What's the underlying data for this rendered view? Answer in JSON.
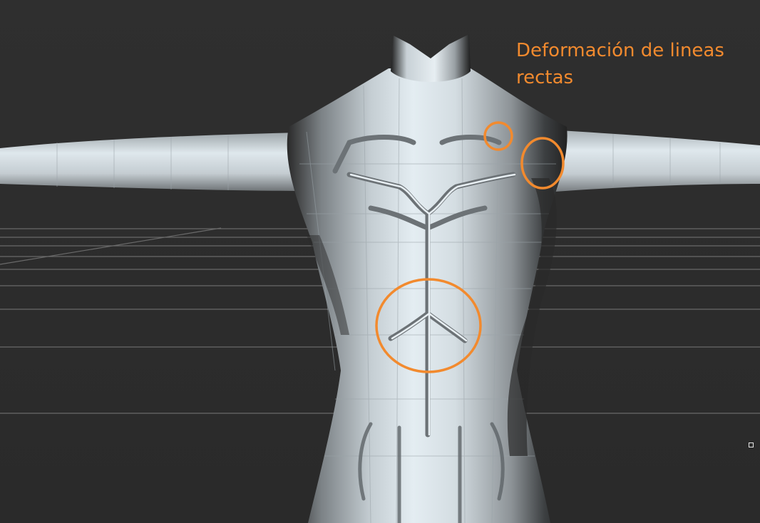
{
  "annotation": {
    "label": "Deformación de lineas rectas",
    "color": "#f28a2e"
  },
  "viewport": {
    "background": "#2d2d2d",
    "grid_color": "#6a6a6a",
    "model_shade_light": "#d9e4ea",
    "model_shade_dark": "#3a3a3a"
  }
}
